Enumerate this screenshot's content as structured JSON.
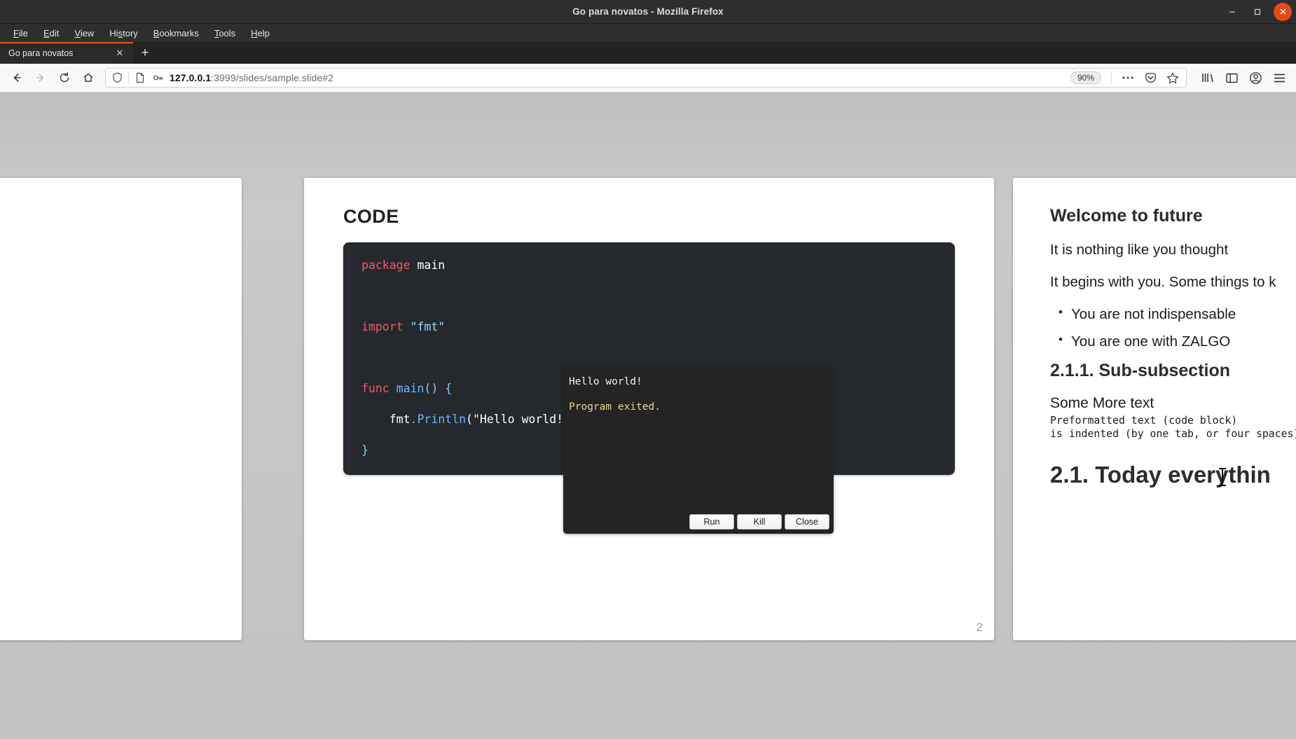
{
  "window": {
    "title": "Go para novatos - Mozilla Firefox",
    "minimize_label": "–",
    "maximize_label": "❐",
    "close_label": "✕"
  },
  "menubar": {
    "items": [
      {
        "label": "File",
        "accel": "F"
      },
      {
        "label": "Edit",
        "accel": "E"
      },
      {
        "label": "View",
        "accel": "V"
      },
      {
        "label": "History",
        "accel": "s"
      },
      {
        "label": "Bookmarks",
        "accel": "B"
      },
      {
        "label": "Tools",
        "accel": "T"
      },
      {
        "label": "Help",
        "accel": "H"
      }
    ]
  },
  "tabs": {
    "active_tab_label": "Go para novatos",
    "close_glyph": "✕",
    "new_tab_glyph": "+"
  },
  "navigation": {
    "back_glyph": "←",
    "forward_glyph": "→",
    "reload_glyph": "↻",
    "home_glyph": "⌂",
    "url_host": "127.0.0.1",
    "url_rest": ":3999/slides/sample.slide#2",
    "url_full": "127.0.0.1:3999/slides/sample.slide#2",
    "zoom_level": "90%",
    "more_glyph": "•••",
    "pocket_glyph": "pocket-icon",
    "bookmark_glyph": "☆",
    "library_glyph": "library-icon",
    "sidebar_glyph": "sidebar-icon",
    "account_glyph": "account-icon",
    "menu_glyph": "☰"
  },
  "slide_current": {
    "title": "CODE",
    "code": {
      "line1_kw": "package",
      "line1_rest": " main",
      "line2_kw": "import",
      "line2_str": " \"fmt\"",
      "line3_kw": "func",
      "line3_fn": " main",
      "line3_pun": "() {",
      "line4_recv": "    fmt",
      "line4_fn": ".Println",
      "line4_args": "(\"Hello world!\")",
      "line5": "}"
    },
    "playground": {
      "stdout": "Hello world!",
      "status": "Program exited.",
      "buttons": [
        "Run",
        "Kill",
        "Close"
      ]
    },
    "page_number": "2"
  },
  "slide_next": {
    "heading": "Welcome to future",
    "para1": "It is nothing like you thought",
    "para2": "It begins with you. Some things to k",
    "bullets": [
      "You are not indispensable",
      "You are one with ZALGO"
    ],
    "subsection": "2.1.1. Sub-subsection",
    "some_more": "Some More text",
    "pre_line1": "Preformatted text (code block)",
    "pre_line2": "is indented (by one tab, or four spaces)",
    "big_heading": "2.1. Today everythin"
  }
}
